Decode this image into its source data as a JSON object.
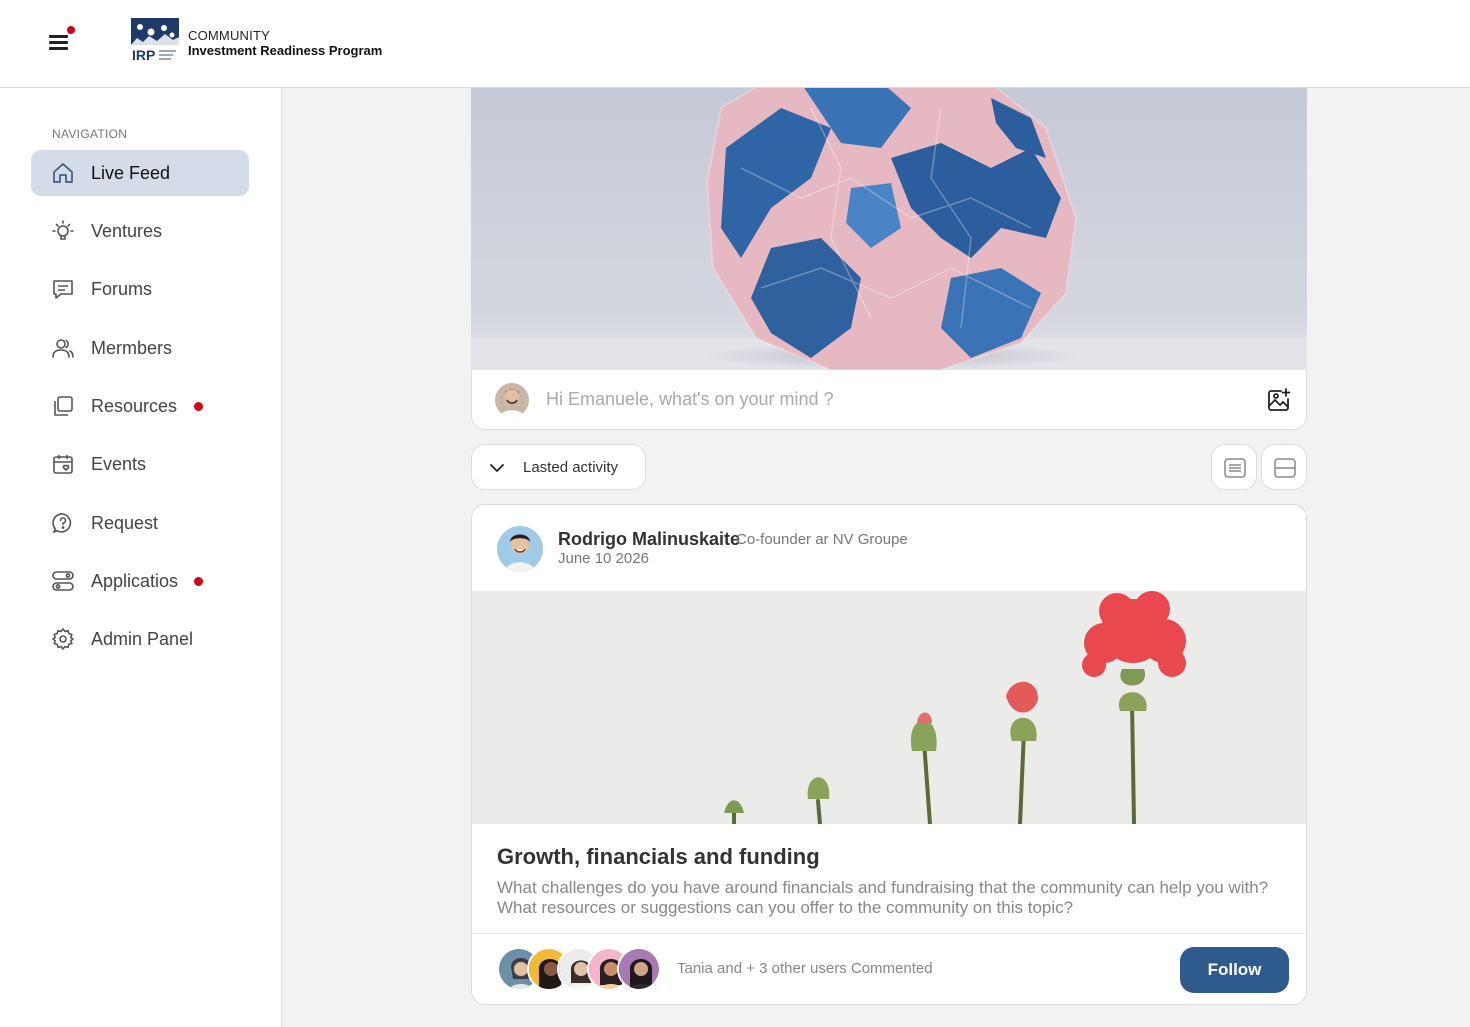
{
  "header": {
    "brand_small": "COMMUNITY",
    "brand_name": "Investment Readiness Program",
    "logo_text": "IRP",
    "notification_color": "#d0021b"
  },
  "sidebar": {
    "heading": "NAVIGATION",
    "items": [
      {
        "label": "Live Feed",
        "icon": "home-icon",
        "active": true
      },
      {
        "label": "Ventures",
        "icon": "lightbulb-icon"
      },
      {
        "label": "Forums",
        "icon": "chat-icon"
      },
      {
        "label": "Mermbers",
        "icon": "users-icon"
      },
      {
        "label": "Resources",
        "icon": "folders-icon",
        "badge": true
      },
      {
        "label": "Events",
        "icon": "calendar-icon"
      },
      {
        "label": "Request",
        "icon": "help-bubble-icon"
      },
      {
        "label": "Applicatios",
        "icon": "applications-icon",
        "badge": true
      },
      {
        "label": "Admin Panel",
        "icon": "gear-icon"
      }
    ]
  },
  "composer": {
    "placeholder": "Hi Emanuele, what's on your mind ?"
  },
  "feed": {
    "sort_label": "Lasted activity"
  },
  "post": {
    "author": "Rodrigo Malinuskaite",
    "role": "Co-founder ar NV Groupe",
    "date": "June 10 2026",
    "title": "Growth, financials and funding",
    "body": "What challenges do you have around financials and fundraising that the community can help you with? What resources or suggestions can you offer to the community on this topic?",
    "commented": "Tania and + 3 other users Commented",
    "follow_label": "Follow"
  },
  "colors": {
    "accent": "#2f5a8c",
    "active_nav": "#d3dce8",
    "badge": "#d0021b"
  }
}
